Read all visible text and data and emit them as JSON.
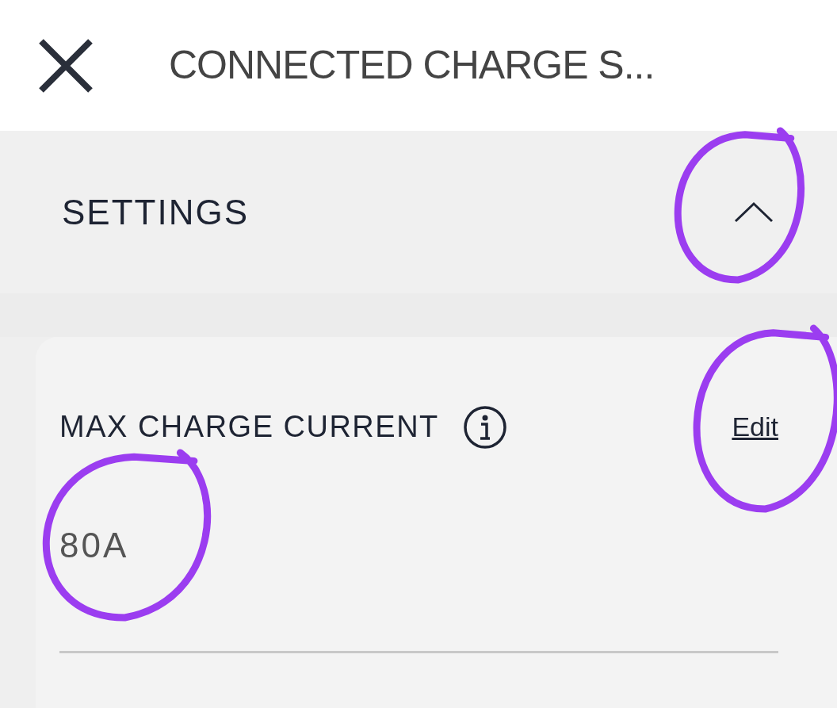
{
  "header": {
    "title": "CONNECTED CHARGE S..."
  },
  "section": {
    "title": "SETTINGS",
    "expanded": true,
    "toggle_circled": true
  },
  "setting": {
    "label": "MAX CHARGE CURRENT",
    "action": "Edit",
    "action_circled": true,
    "value": "80A",
    "value_circled": true
  }
}
